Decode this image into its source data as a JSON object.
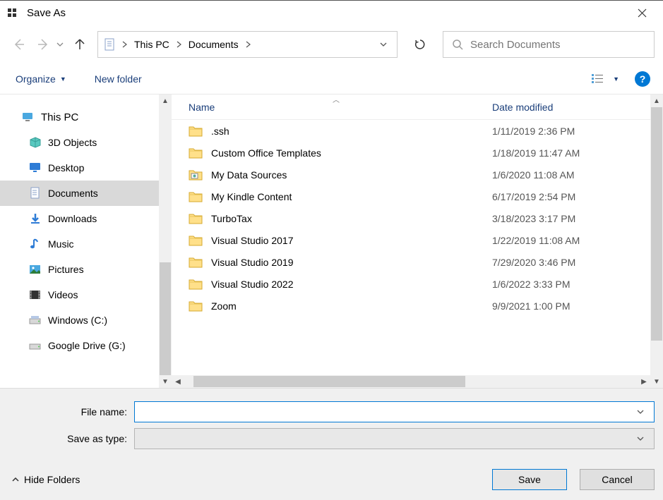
{
  "title": "Save As",
  "breadcrumb": {
    "items": [
      "This PC",
      "Documents"
    ]
  },
  "search": {
    "placeholder": "Search Documents"
  },
  "toolbar": {
    "organize": "Organize",
    "newfolder": "New folder"
  },
  "tree": {
    "root": "This PC",
    "items": [
      {
        "label": "3D Objects",
        "icon": "cube"
      },
      {
        "label": "Desktop",
        "icon": "desktop"
      },
      {
        "label": "Documents",
        "icon": "doc",
        "selected": true
      },
      {
        "label": "Downloads",
        "icon": "download"
      },
      {
        "label": "Music",
        "icon": "music"
      },
      {
        "label": "Pictures",
        "icon": "pictures"
      },
      {
        "label": "Videos",
        "icon": "videos"
      },
      {
        "label": "Windows (C:)",
        "icon": "drive"
      },
      {
        "label": "Google Drive (G:)",
        "icon": "drive2"
      }
    ]
  },
  "columns": {
    "name": "Name",
    "date": "Date modified"
  },
  "files": [
    {
      "name": ".ssh",
      "date": "1/11/2019 2:36 PM",
      "icon": "folder"
    },
    {
      "name": "Custom Office Templates",
      "date": "1/18/2019 11:47 AM",
      "icon": "folder"
    },
    {
      "name": "My Data Sources",
      "date": "1/6/2020 11:08 AM",
      "icon": "folder-special"
    },
    {
      "name": "My Kindle Content",
      "date": "6/17/2019 2:54 PM",
      "icon": "folder"
    },
    {
      "name": "TurboTax",
      "date": "3/18/2023 3:17 PM",
      "icon": "folder"
    },
    {
      "name": "Visual Studio 2017",
      "date": "1/22/2019 11:08 AM",
      "icon": "folder"
    },
    {
      "name": "Visual Studio 2019",
      "date": "7/29/2020 3:46 PM",
      "icon": "folder"
    },
    {
      "name": "Visual Studio 2022",
      "date": "1/6/2022 3:33 PM",
      "icon": "folder"
    },
    {
      "name": "Zoom",
      "date": "9/9/2021 1:00 PM",
      "icon": "folder"
    }
  ],
  "fields": {
    "filename_label": "File name:",
    "filename_value": "",
    "savetype_label": "Save as type:",
    "savetype_value": ""
  },
  "buttons": {
    "hidefolders": "Hide Folders",
    "save": "Save",
    "cancel": "Cancel"
  }
}
